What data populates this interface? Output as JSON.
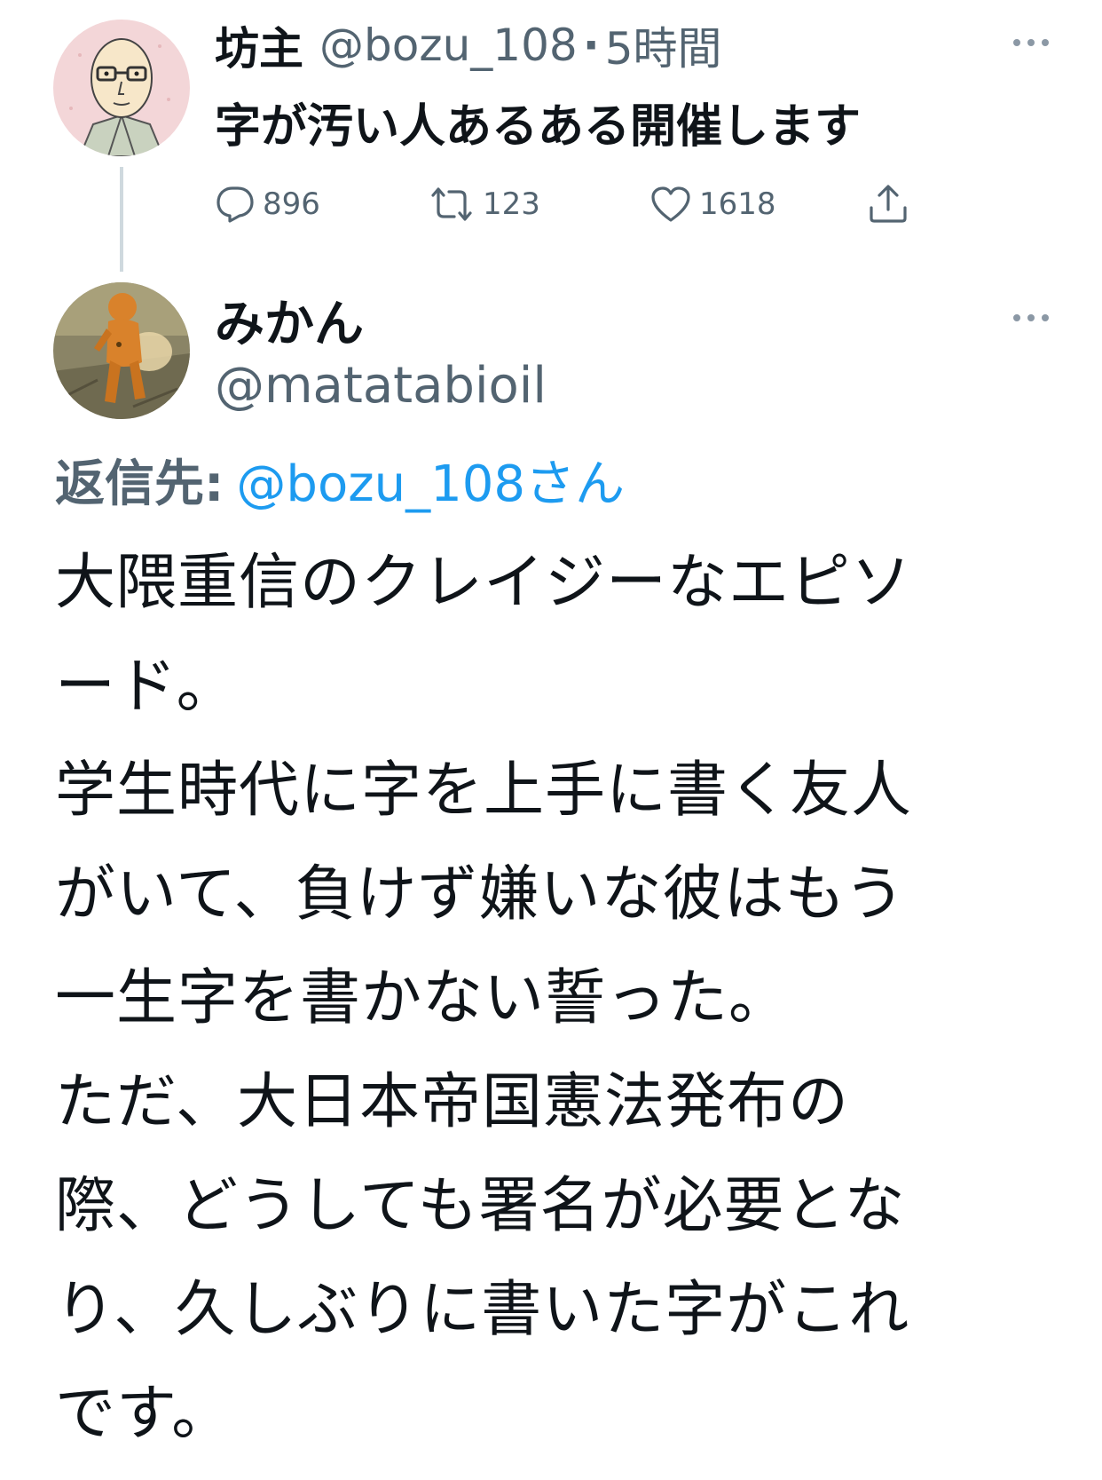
{
  "parent_tweet": {
    "display_name": "坊主",
    "handle": "@bozu_108",
    "separator": "·",
    "time": "5時間",
    "text": "字が汚い人あるある開催します",
    "avatar_icon": "cartoon-monk-avatar",
    "more_icon": "more-dots-icon",
    "actions": {
      "reply": {
        "icon": "reply-bubble-icon",
        "count": "896"
      },
      "retweet": {
        "icon": "retweet-arrows-icon",
        "count": "123"
      },
      "like": {
        "icon": "heart-icon",
        "count": "1618"
      },
      "share": {
        "icon": "share-upload-icon"
      }
    }
  },
  "reply_tweet": {
    "display_name": "みかん",
    "handle": "@matatabioil",
    "avatar_icon": "orange-figure-avatar",
    "more_icon": "more-dots-icon",
    "replying_to_label": "返信先:",
    "replying_to_handle": "@bozu_108さん",
    "body_lines": [
      "大隈重信のクレイジーなエピソ",
      "ード。",
      "学生時代に字を上手に書く友人",
      "がいて、負けず嫌いな彼はもう",
      "一生字を書かない誓った。",
      "ただ、大日本帝国憲法発布の",
      "際、どうしても署名が必要とな",
      "り、久しぶりに書いた字がこれ",
      "です。"
    ]
  },
  "colors": {
    "text_primary": "#0f1419",
    "text_secondary": "#536471",
    "link": "#1d9bf0",
    "thread_line": "#cfd9de",
    "background": "#ffffff"
  }
}
